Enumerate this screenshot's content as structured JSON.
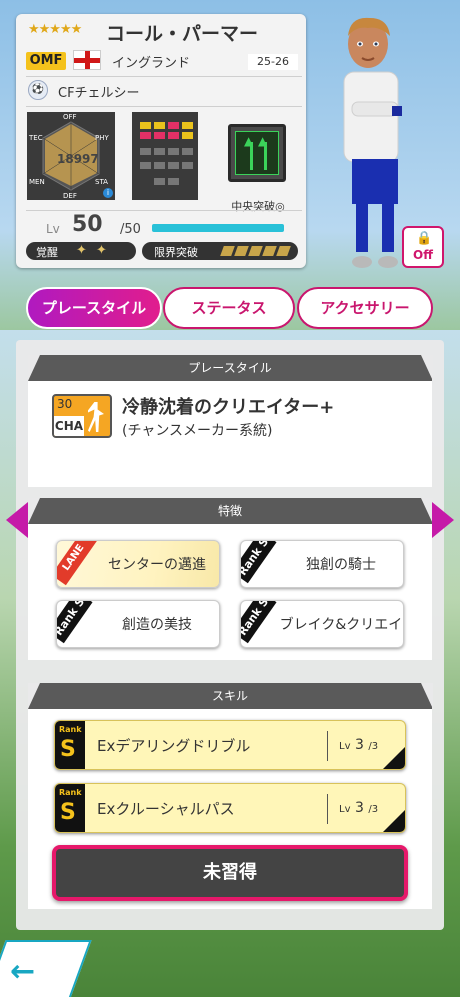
{
  "player": {
    "stars": "★★★★★",
    "name": "コール・パーマー",
    "position": "OMF",
    "nation": "イングランド",
    "season": "25-26",
    "club": "CFチェルシー",
    "rating": "18997",
    "hex_labels": {
      "off": "OFF",
      "tec": "TEC",
      "phy": "PHY",
      "men": "MEN",
      "sta": "STA",
      "def": "DEF"
    },
    "tactic": "中央突破◎",
    "level_prefix": "Lv",
    "level": "50",
    "level_max": "/50",
    "level_progress": 1.0,
    "awakening_label": "覚醒",
    "awakening_stars": 2,
    "limit_break_label": "限界突破",
    "limit_break_count": 5,
    "off_label": "Off"
  },
  "tabs": [
    {
      "label": "プレースタイル",
      "active": true
    },
    {
      "label": "ステータス",
      "active": false
    },
    {
      "label": "アクセサリー",
      "active": false
    }
  ],
  "playstyle": {
    "header": "プレースタイル",
    "icon_level": "30",
    "icon_code": "CHA",
    "title": "冷静沈着のクリエイター+",
    "subtitle": "(チャンスメーカー系統)"
  },
  "traits": {
    "header": "特徴",
    "items": [
      {
        "label": "センターの邁進",
        "badge": "LANE",
        "style": "gold"
      },
      {
        "label": "独創の騎士",
        "badge": "Rank S",
        "style": "white"
      },
      {
        "label": "創造の美技",
        "badge": "Rank S",
        "style": "white"
      },
      {
        "label": "ブレイク&クリエイト",
        "badge": "Rank S",
        "style": "white"
      }
    ]
  },
  "skills": {
    "header": "スキル",
    "items": [
      {
        "rank_label": "Rank",
        "rank": "S",
        "name": "Exデアリングドリブル",
        "lv_prefix": "Lv",
        "lv": "3",
        "lv_max": "/3"
      },
      {
        "rank_label": "Rank",
        "rank": "S",
        "name": "Exクルーシャルパス",
        "lv_prefix": "Lv",
        "lv": "3",
        "lv_max": "/3"
      }
    ],
    "learn_button": "未習得"
  },
  "colors": {
    "accent": "#c9166e",
    "tab_gradient_start": "#b01ac0",
    "level_bar": "#29c1d8",
    "back": "#18a7c2"
  }
}
